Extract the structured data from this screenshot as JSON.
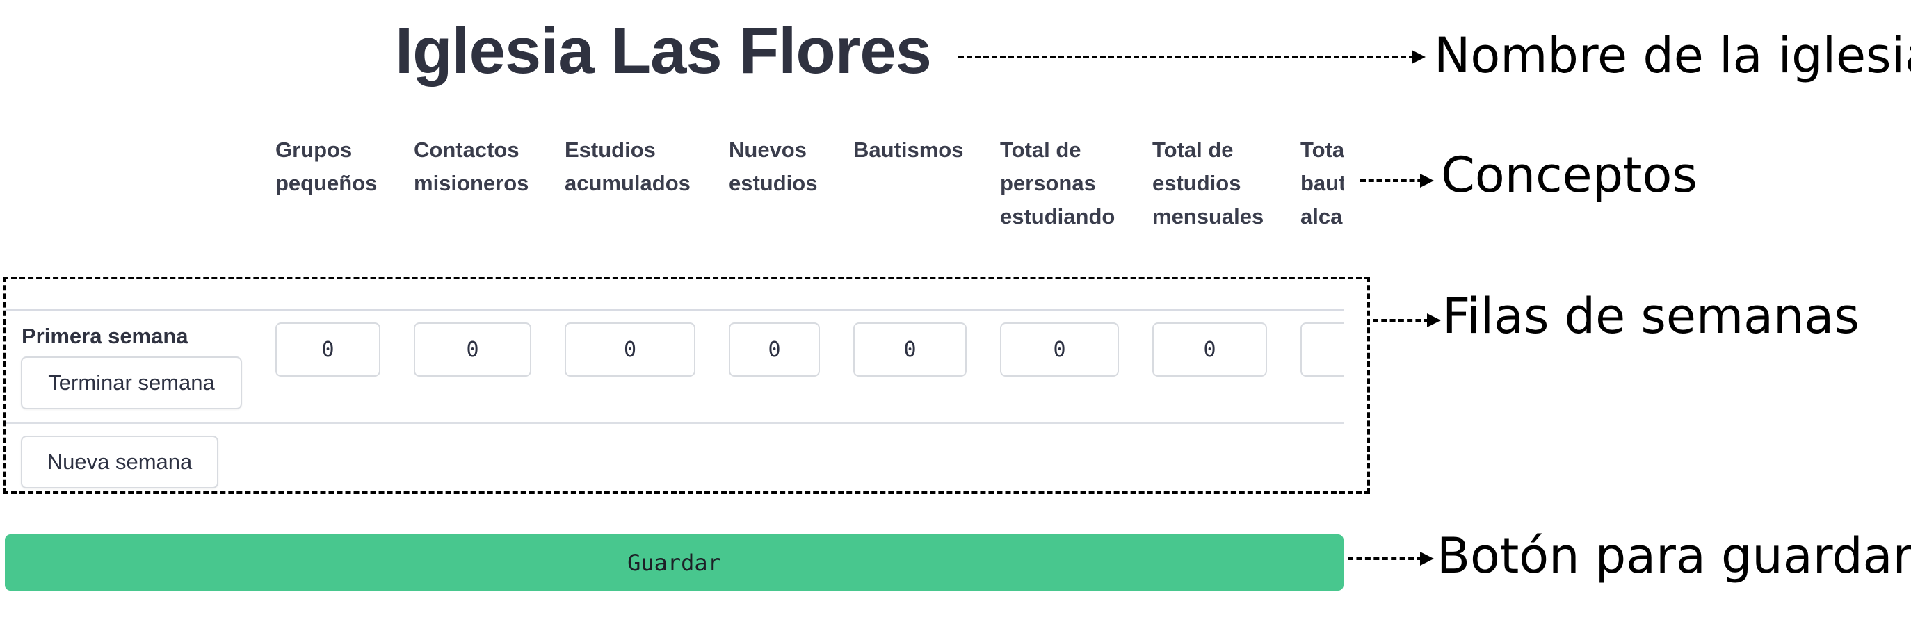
{
  "church": {
    "name": "Iglesia Las Flores"
  },
  "annotations": {
    "church_name": "Nombre de la iglesia",
    "concepts": "Conceptos",
    "week_rows": "Filas de semanas",
    "save_button": "Botón para guardar"
  },
  "table": {
    "columns": [
      "Grupos\npequeños",
      "Contactos\nmisioneros",
      "Estudios\nacumulados",
      "Nuevos\nestudios",
      "Bautismos",
      "Total de\npersonas\nestudiando",
      "Total de\nestudios\nmensuales",
      "Total de\nbautismos\nalcanzados"
    ],
    "rows": [
      {
        "label": "Primera semana",
        "end_week_label": "Terminar semana",
        "values": [
          "0",
          "0",
          "0",
          "0",
          "0",
          "0",
          "0",
          ""
        ]
      }
    ],
    "new_week_label": "Nueva semana"
  },
  "actions": {
    "save_label": "Guardar"
  },
  "colors": {
    "save_button": "#48c78e",
    "title": "#2f3240",
    "input_border": "#d8dbe0"
  }
}
